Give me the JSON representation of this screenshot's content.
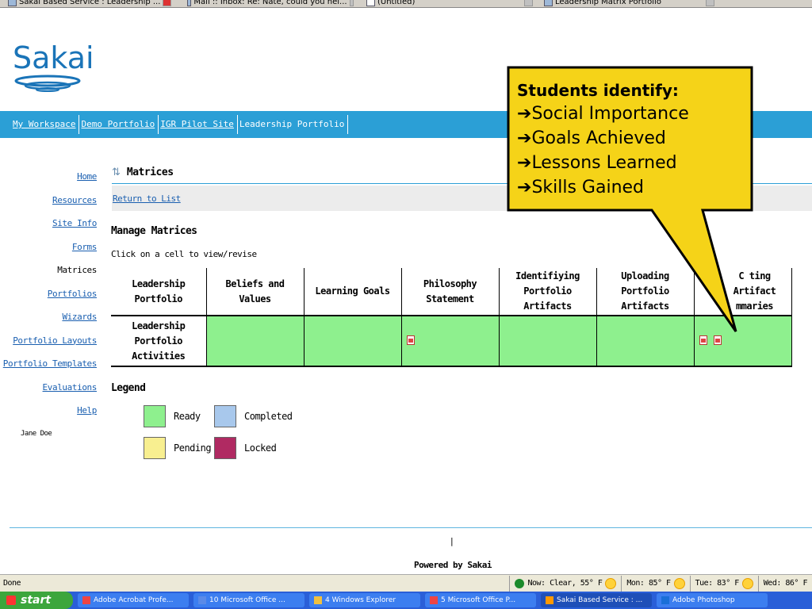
{
  "browser_tabs": [
    {
      "label": "Sakai Based Service : Leadership ...",
      "close": "red"
    },
    {
      "label": "Mail :: Inbox: Re: Nate, could you hel...",
      "close": "gray"
    },
    {
      "label": "(Untitled)",
      "close": "gray"
    },
    {
      "label": "Leadership Matrix Portfolio",
      "close": "gray"
    }
  ],
  "logo": {
    "text": "Sakai"
  },
  "site_nav": [
    {
      "label": "My Workspace",
      "current": false
    },
    {
      "label": "Demo Portfolio",
      "current": false
    },
    {
      "label": "IGR Pilot Site",
      "current": false
    },
    {
      "label": "Leadership Portfolio",
      "current": true
    }
  ],
  "left_nav": [
    {
      "label": "Home",
      "current": false
    },
    {
      "label": "Resources",
      "current": false
    },
    {
      "label": "Site Info",
      "current": false
    },
    {
      "label": "Forms",
      "current": false
    },
    {
      "label": "Matrices",
      "current": true
    },
    {
      "label": "Portfolios",
      "current": false
    },
    {
      "label": "Wizards",
      "current": false
    },
    {
      "label": "Portfolio Layouts",
      "current": false
    },
    {
      "label": "Portfolio Templates",
      "current": false
    },
    {
      "label": "Evaluations",
      "current": false
    },
    {
      "label": "Help",
      "current": false
    }
  ],
  "user": {
    "name": "Jane Doe"
  },
  "main": {
    "title": "Matrices",
    "return_link": "Return to List",
    "heading": "Manage Matrices",
    "instruction": "Click on a cell to view/revise",
    "matrix": {
      "corner_line1": "Leadership",
      "corner_line2": "Portfolio",
      "columns": [
        {
          "line1": "Beliefs and",
          "line2": "Values"
        },
        {
          "line1": "Learning Goals",
          "line2": ""
        },
        {
          "line1": "Philosophy",
          "line2": "Statement"
        },
        {
          "line1": "Identifiying",
          "line2": "Portfolio Artifacts"
        },
        {
          "line1": "Uploading",
          "line2": "Portfolio Artifacts"
        },
        {
          "line1": "C  ting Artifact",
          "line2": "mmaries"
        }
      ],
      "row": {
        "line1": "Leadership",
        "line2": "Portfolio",
        "line3": "Activities",
        "cell_files": [
          0,
          0,
          1,
          0,
          0,
          2
        ]
      }
    },
    "legend": {
      "title": "Legend",
      "items": [
        {
          "label": "Ready",
          "color": "#8ef08e"
        },
        {
          "label": "Completed",
          "color": "#a8c8ec"
        },
        {
          "label": "Pending",
          "color": "#f8ef90"
        },
        {
          "label": "Locked",
          "color": "#b02a62"
        }
      ]
    }
  },
  "footer": {
    "separator": "|",
    "powered": "Powered by Sakai"
  },
  "status_bar": {
    "text": "Done",
    "weather": [
      "Now: Clear, 55° F",
      "Mon: 85° F",
      "Tue: 83° F",
      "Wed: 86° F"
    ]
  },
  "taskbar": {
    "start": "start",
    "items": [
      {
        "label": "Adobe Acrobat Profe...",
        "active": false
      },
      {
        "label": "10 Microsoft Office ...",
        "active": false
      },
      {
        "label": "4 Windows Explorer",
        "active": false
      },
      {
        "label": "5 Microsoft Office P...",
        "active": false
      },
      {
        "label": "Sakai Based Service : ...",
        "active": true
      },
      {
        "label": "Adobe Photoshop",
        "active": false
      }
    ]
  },
  "callout": {
    "heading": "Students identify",
    "heading_suffix": ":",
    "arrow": "➔",
    "items": [
      "Social Importance",
      "Goals Achieved",
      "Lessons Learned",
      "Skills Gained"
    ],
    "fill": "#f5d318"
  }
}
